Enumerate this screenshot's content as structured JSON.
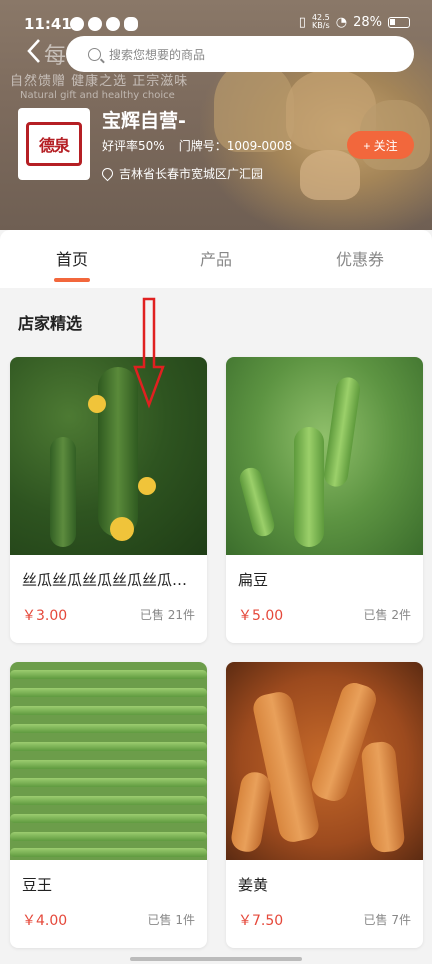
{
  "status_bar": {
    "time": "11:41",
    "network_speed": "42.5",
    "speed_unit": "KB/s",
    "battery": "28%"
  },
  "search": {
    "placeholder": "搜索您想要的商品"
  },
  "banner": {
    "slogan_cn": "自然馈赠 健康之选 正宗滋味",
    "slogan_en": "Natural gift and healthy choice",
    "ghost_text": "每"
  },
  "shop": {
    "logo_text": "德泉",
    "name": "宝辉自营-",
    "rating_label": "好评率50%",
    "door_no": "门牌号：1009-0008",
    "location": "吉林省长春市宽城区广汇园",
    "follow_label": "+ 关注"
  },
  "tabs": [
    {
      "label": "首页",
      "active": true
    },
    {
      "label": "产品",
      "active": false
    },
    {
      "label": "优惠券",
      "active": false
    }
  ],
  "section": {
    "title": "店家精选"
  },
  "products": [
    {
      "name": "丝瓜丝瓜丝瓜丝瓜丝瓜丝瓜丝瓜",
      "price": "￥3.00",
      "sold": "已售 21件",
      "image": "loofah"
    },
    {
      "name": "扁豆",
      "price": "￥5.00",
      "sold": "已售 2件",
      "image": "peas"
    },
    {
      "name": "豆王",
      "price": "￥4.00",
      "sold": "已售 1件",
      "image": "green-beans"
    },
    {
      "name": "姜黄",
      "price": "￥7.50",
      "sold": "已售 7件",
      "image": "turmeric"
    }
  ],
  "colors": {
    "accent": "#f2673c",
    "price": "#e5483a",
    "annotation_arrow": "#e02020"
  }
}
